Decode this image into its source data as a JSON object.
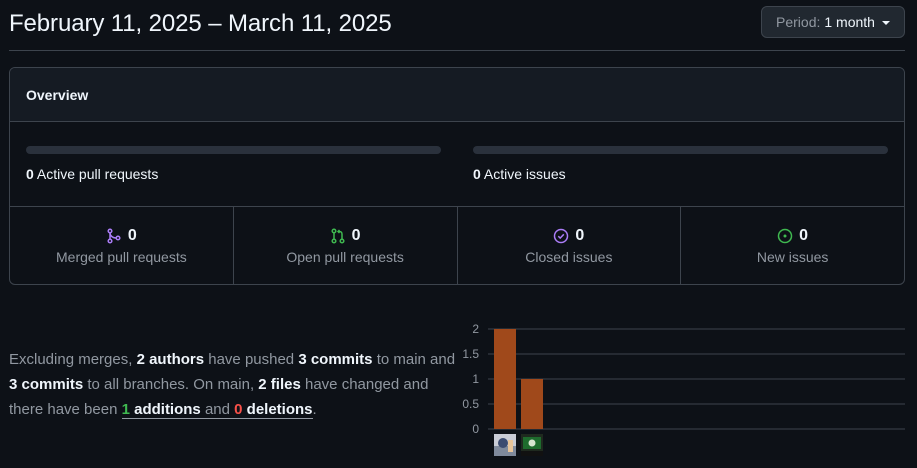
{
  "header": {
    "date_range": "February 11, 2025 – March 11, 2025",
    "period_label": "Period:",
    "period_value": "1 month"
  },
  "overview": {
    "title": "Overview",
    "active_pull_requests": {
      "count": "0",
      "label": "Active pull requests",
      "fraction": 0
    },
    "active_issues": {
      "count": "0",
      "label": "Active issues",
      "fraction": 0
    },
    "stats": [
      {
        "icon": "merged-pr-icon",
        "count": "0",
        "label": "Merged pull requests",
        "color": "#ab7df8"
      },
      {
        "icon": "open-pr-icon",
        "count": "0",
        "label": "Open pull requests",
        "color": "#3fb950"
      },
      {
        "icon": "closed-issue-icon",
        "count": "0",
        "label": "Closed issues",
        "color": "#ab7df8"
      },
      {
        "icon": "new-issue-icon",
        "count": "0",
        "label": "New issues",
        "color": "#3fb950"
      }
    ]
  },
  "summary": {
    "t1": "Excluding merges, ",
    "authors": "2 authors",
    "t2": " have pushed ",
    "commits_main": "3 commits",
    "t3": " to main and ",
    "commits_all": "3 commits",
    "t4": " to all branches. On main, ",
    "files": "2 files",
    "t5": " have changed and there have been ",
    "additions_count": "1",
    "additions_label": " additions",
    "t6": " and ",
    "deletions_count": "0",
    "deletions_label": " deletions",
    "t7": "."
  },
  "chart_data": {
    "type": "bar",
    "categories": [
      "author-1",
      "author-2"
    ],
    "values": [
      2,
      1
    ],
    "ylim": [
      0,
      2
    ],
    "yticks": [
      "2",
      "1.5",
      "1",
      "0.5",
      "0"
    ],
    "bar_color": "#a0491b",
    "grid": true
  }
}
